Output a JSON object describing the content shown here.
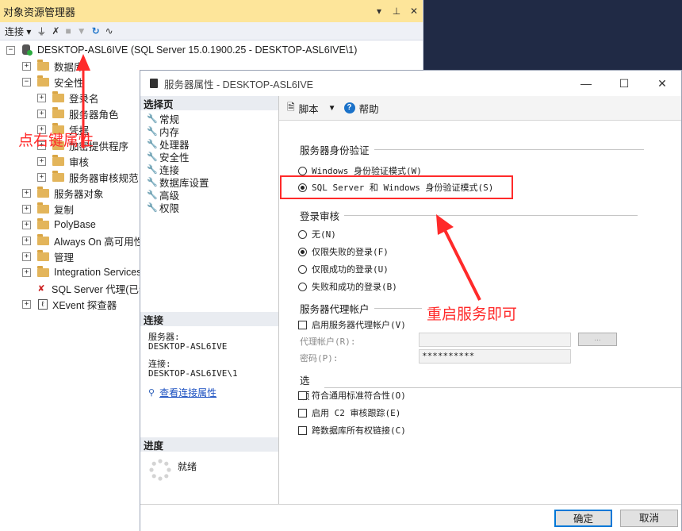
{
  "object_explorer": {
    "title": "对象资源管理器",
    "title_controls": [
      "▾",
      "📌",
      "✕"
    ],
    "toolbar": {
      "connect_label": "连接"
    },
    "server_node": "DESKTOP-ASL6IVE (SQL Server 15.0.1900.25 - DESKTOP-ASL6IVE\\1)",
    "items": [
      {
        "label": "数据库"
      },
      {
        "label": "安全性"
      },
      {
        "label": "登录名"
      },
      {
        "label": "服务器角色"
      },
      {
        "label": "凭据"
      },
      {
        "label": "加密提供程序"
      },
      {
        "label": "审核"
      },
      {
        "label": "服务器审核规范"
      },
      {
        "label": "服务器对象"
      },
      {
        "label": "复制"
      },
      {
        "label": "PolyBase"
      },
      {
        "label": "Always On 高可用性"
      },
      {
        "label": "管理"
      },
      {
        "label": "Integration Services"
      },
      {
        "label": "SQL Server 代理(已禁用)"
      },
      {
        "label": "XEvent 探查器"
      }
    ]
  },
  "annotations": {
    "right_click": "点右键属性",
    "restart": "重启服务即可",
    "color": "#ff2a2a"
  },
  "dialog": {
    "title": "服务器属性 - DESKTOP-ASL6IVE",
    "select_page_header": "选择页",
    "pages": [
      "常规",
      "内存",
      "处理器",
      "安全性",
      "连接",
      "数据库设置",
      "高级",
      "权限"
    ],
    "connection_header": "连接",
    "server_label": "服务器:",
    "server_value": "DESKTOP-ASL6IVE",
    "connection_label": "连接:",
    "connection_value": "DESKTOP-ASL6IVE\\1",
    "view_conn_props": "查看连接属性",
    "progress_header": "进度",
    "progress_status": "就绪",
    "toolbar": {
      "script": "脚本",
      "help": "帮助"
    },
    "auth_group": "服务器身份验证",
    "auth_windows": "Windows 身份验证模式(W)",
    "auth_mixed": "SQL Server 和 Windows 身份验证模式(S)",
    "auth_selected": "mixed",
    "login_audit_group": "登录审核",
    "audit_none": "无(N)",
    "audit_failed": "仅限失败的登录(F)",
    "audit_success": "仅限成功的登录(U)",
    "audit_both": "失败和成功的登录(B)",
    "audit_selected": "failed",
    "proxy_group": "服务器代理帐户",
    "proxy_enable": "启用服务器代理帐户(V)",
    "proxy_account_label": "代理帐户(R):",
    "proxy_password_label": "密码(P):",
    "proxy_password_value": "**********",
    "browse_button": "...",
    "options_group": "选项",
    "opt_common_criteria": "符合通用标准符合性(O)",
    "opt_c2_audit": "启用 C2 审核跟踪(E)",
    "opt_cross_db": "跨数据库所有权链接(C)",
    "ok": "确定",
    "cancel": "取消"
  }
}
